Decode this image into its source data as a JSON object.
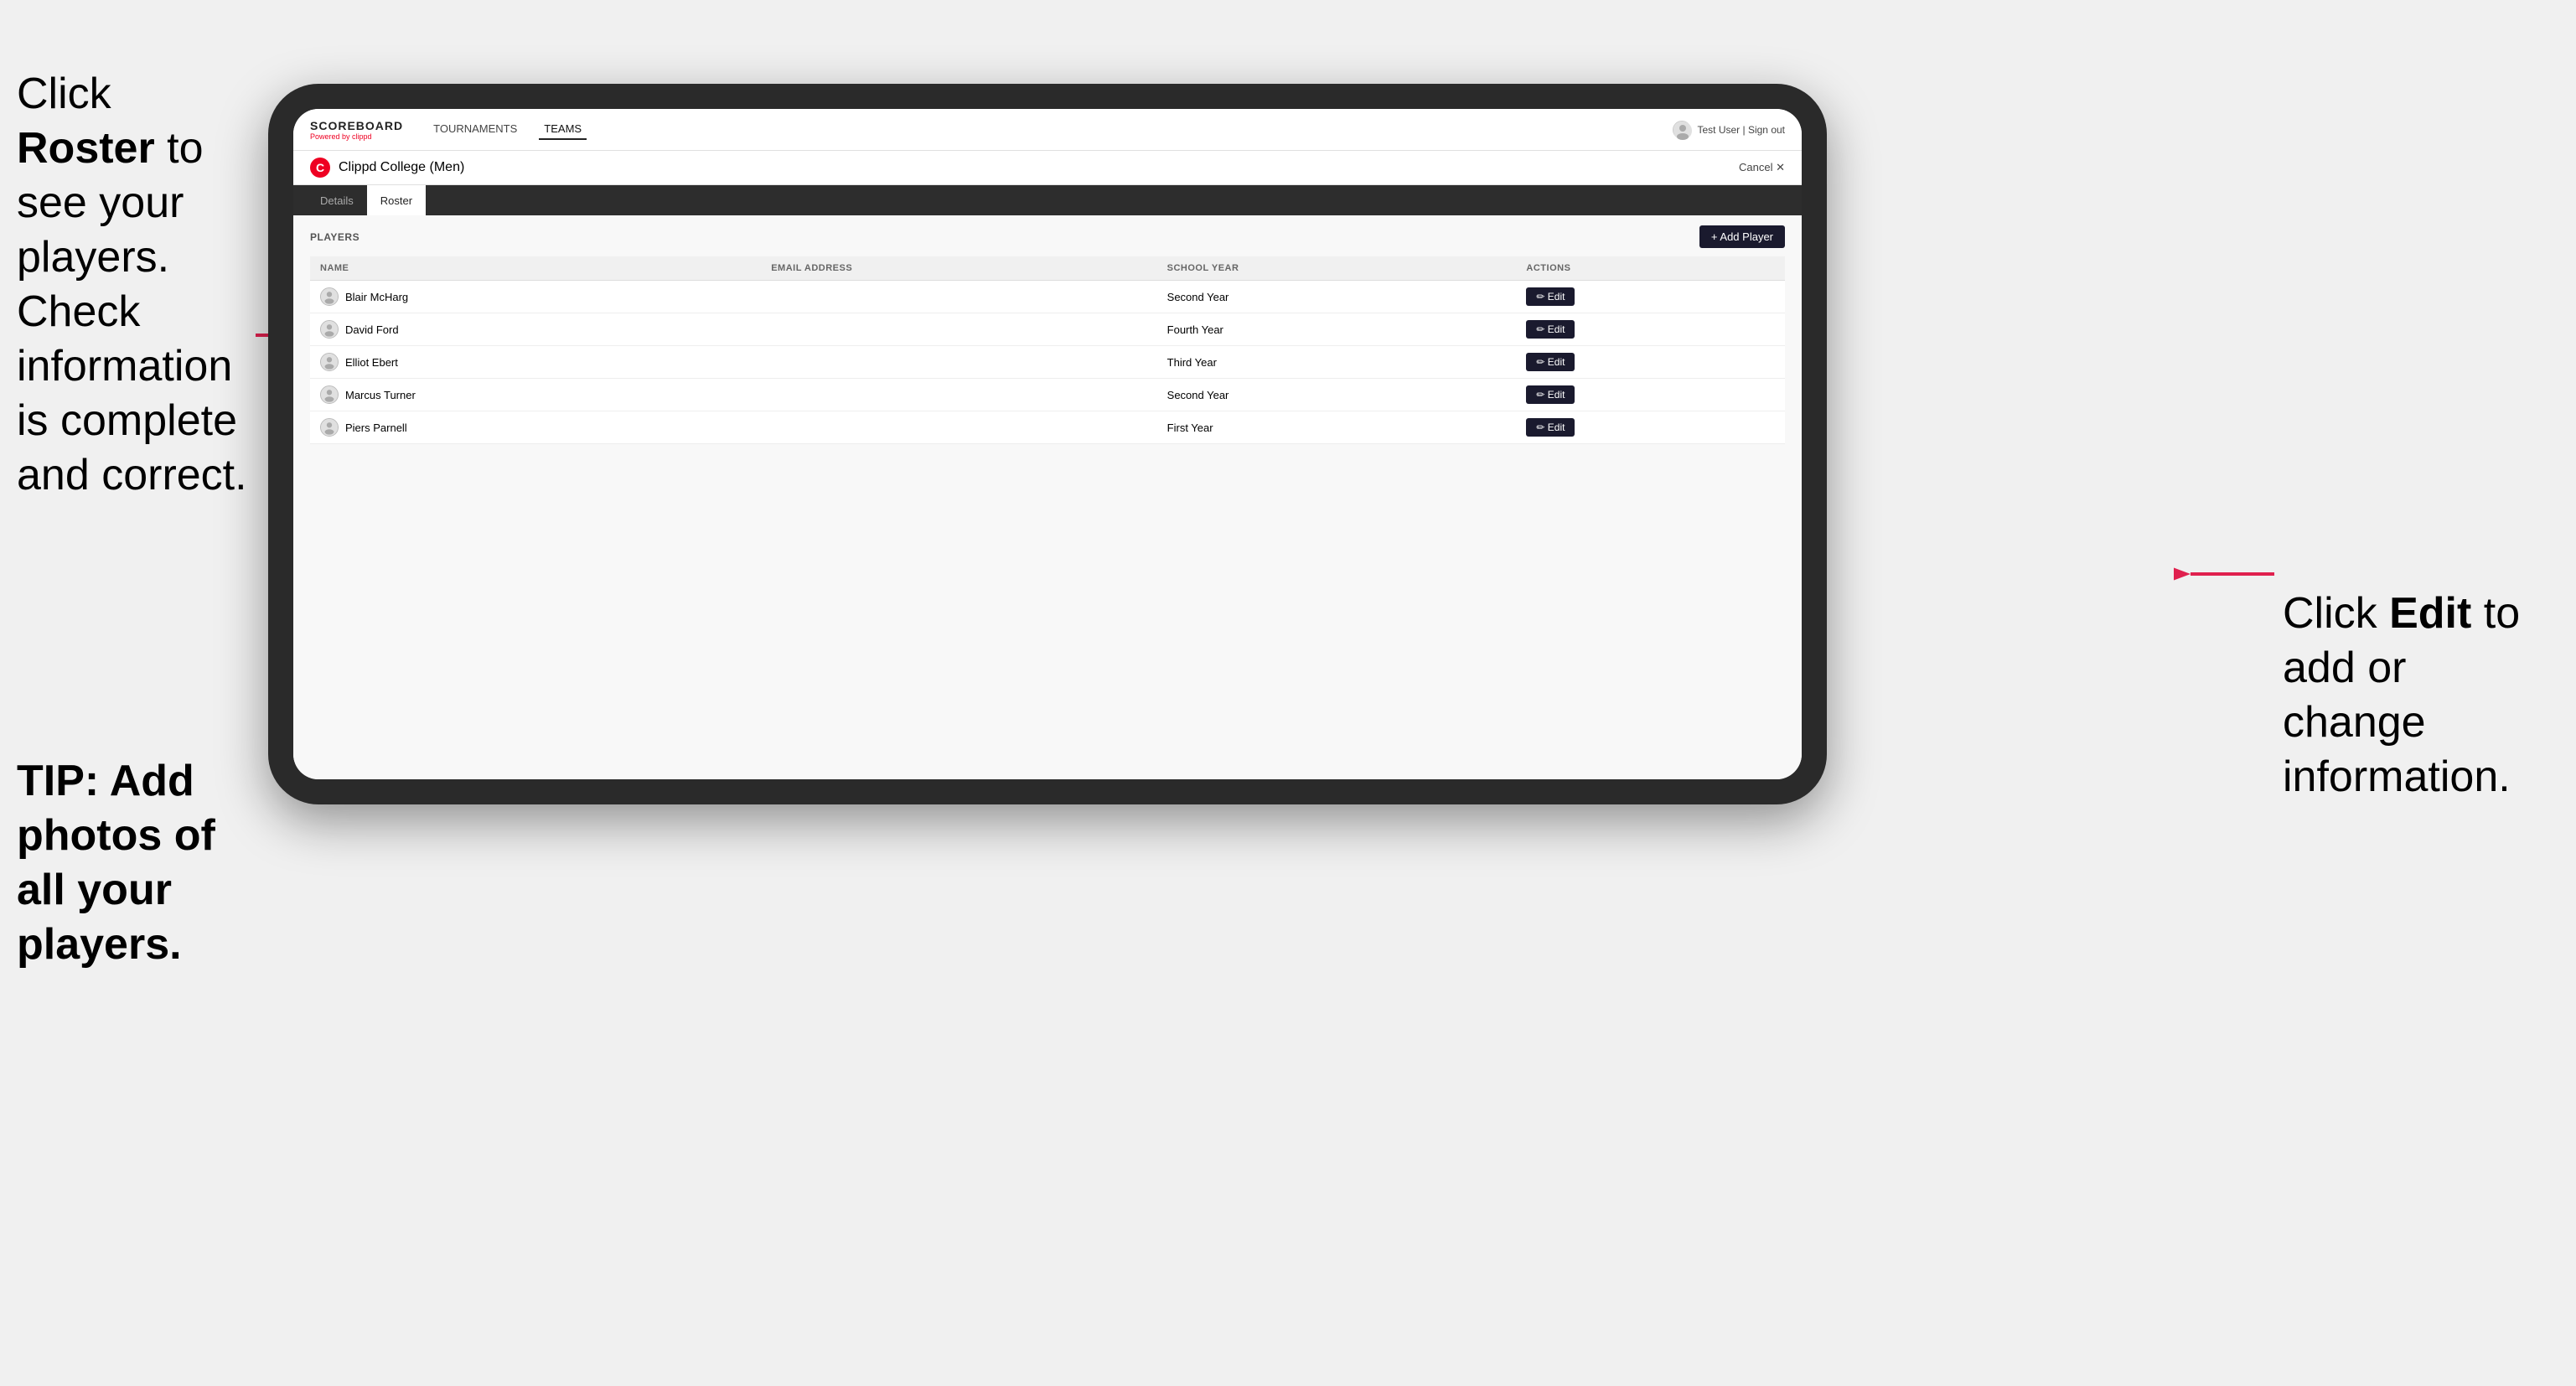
{
  "instructions": {
    "left_line1": "Click ",
    "left_bold": "Roster",
    "left_line2": " to see your players. Check information is complete and correct.",
    "tip_label": "TIP: Add photos of all your players.",
    "right_line1": "Click ",
    "right_bold": "Edit",
    "right_line2": " to add or change information."
  },
  "navbar": {
    "logo_title": "SCOREBOARD",
    "logo_sub": "Powered by clippd",
    "nav_items": [
      {
        "label": "TOURNAMENTS",
        "active": false
      },
      {
        "label": "TEAMS",
        "active": true
      }
    ],
    "user_label": "Test User | Sign out"
  },
  "team": {
    "icon_letter": "C",
    "name": "Clippd College (Men)",
    "cancel_label": "Cancel ✕"
  },
  "tabs": [
    {
      "label": "Details",
      "active": false
    },
    {
      "label": "Roster",
      "active": true
    }
  ],
  "players_section": {
    "header_label": "PLAYERS",
    "add_player_label": "+ Add Player",
    "columns": [
      {
        "key": "name",
        "label": "NAME"
      },
      {
        "key": "email",
        "label": "EMAIL ADDRESS"
      },
      {
        "key": "school_year",
        "label": "SCHOOL YEAR"
      },
      {
        "key": "actions",
        "label": "ACTIONS"
      }
    ],
    "players": [
      {
        "name": "Blair McHarg",
        "email": "",
        "school_year": "Second Year"
      },
      {
        "name": "David Ford",
        "email": "",
        "school_year": "Fourth Year"
      },
      {
        "name": "Elliot Ebert",
        "email": "",
        "school_year": "Third Year"
      },
      {
        "name": "Marcus Turner",
        "email": "",
        "school_year": "Second Year"
      },
      {
        "name": "Piers Parnell",
        "email": "",
        "school_year": "First Year"
      }
    ],
    "edit_label": "✏ Edit"
  }
}
